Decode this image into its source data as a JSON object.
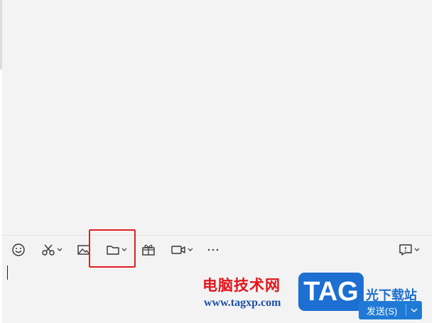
{
  "chat": {
    "messages": []
  },
  "toolbar": {
    "tools": [
      {
        "name": "emoji",
        "icon": "smiley-icon"
      },
      {
        "name": "screenshot",
        "icon": "scissors-icon",
        "has_menu": true
      },
      {
        "name": "image",
        "icon": "image-icon"
      },
      {
        "name": "file",
        "icon": "folder-icon",
        "has_menu": true
      },
      {
        "name": "red-packet",
        "icon": "gift-icon"
      },
      {
        "name": "video-call",
        "icon": "video-camera-icon",
        "has_menu": true
      },
      {
        "name": "more",
        "icon": "more-icon"
      },
      {
        "name": "chat-history",
        "icon": "chat-history-icon",
        "has_menu": true
      }
    ]
  },
  "input": {
    "value": ""
  },
  "send": {
    "label": "发送(S)"
  },
  "watermark": {
    "cn_text": "电脑技术网",
    "url": "www.tagxp.com",
    "logo_text": "TAG",
    "brand": "光下载站"
  },
  "colors": {
    "accent": "#1f7ad6",
    "highlight": "#e02020",
    "background": "#f3f3f3"
  }
}
